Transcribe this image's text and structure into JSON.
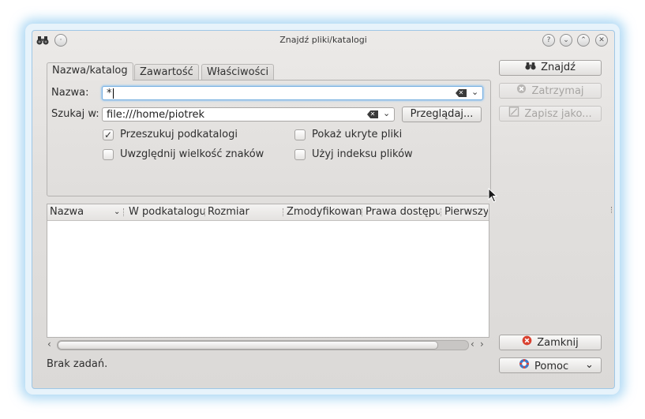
{
  "window": {
    "title": "Znajdź pliki/katalogi"
  },
  "titlebar_buttons": {
    "help": "?",
    "shade": "⌄",
    "maximize": "⌃",
    "close": "✕"
  },
  "tabs": [
    {
      "label": "Nazwa/katalog"
    },
    {
      "label": "Zawartość"
    },
    {
      "label": "Właściwości"
    }
  ],
  "form": {
    "name_label": "Nazwa:",
    "name_value": "*",
    "lookin_label": "Szukaj w:",
    "lookin_value": "file:///home/piotrek",
    "browse_button": "Przeglądaj...",
    "checkboxes": [
      {
        "label": "Przeszukuj podkatalogi",
        "checked": true
      },
      {
        "label": "Pokaż ukryte pliki",
        "checked": false
      },
      {
        "label": "Uwzględnij wielkość znaków",
        "checked": false
      },
      {
        "label": "Użyj indeksu plików",
        "checked": false
      }
    ]
  },
  "results": {
    "columns": [
      "Nazwa",
      "W podkatalogu",
      "Rozmiar",
      "Zmodyfikowano",
      "Prawa dostępu",
      "Pierwszy"
    ]
  },
  "actions": {
    "find": "Znajdź",
    "stop": "Zatrzymaj",
    "save_as": "Zapisz jako...",
    "close": "Zamknij",
    "help": "Pomoc"
  },
  "status": "Brak zadań.",
  "colors": {
    "glow": "#6eb9eb",
    "focus": "#76afe0",
    "close_red": "#d9412f"
  },
  "icons": {
    "app": "binoculars-icon",
    "find": "binoculars-icon",
    "stop": "stop-icon",
    "save": "save-icon",
    "close": "close-icon",
    "help": "lifebuoy-icon"
  }
}
